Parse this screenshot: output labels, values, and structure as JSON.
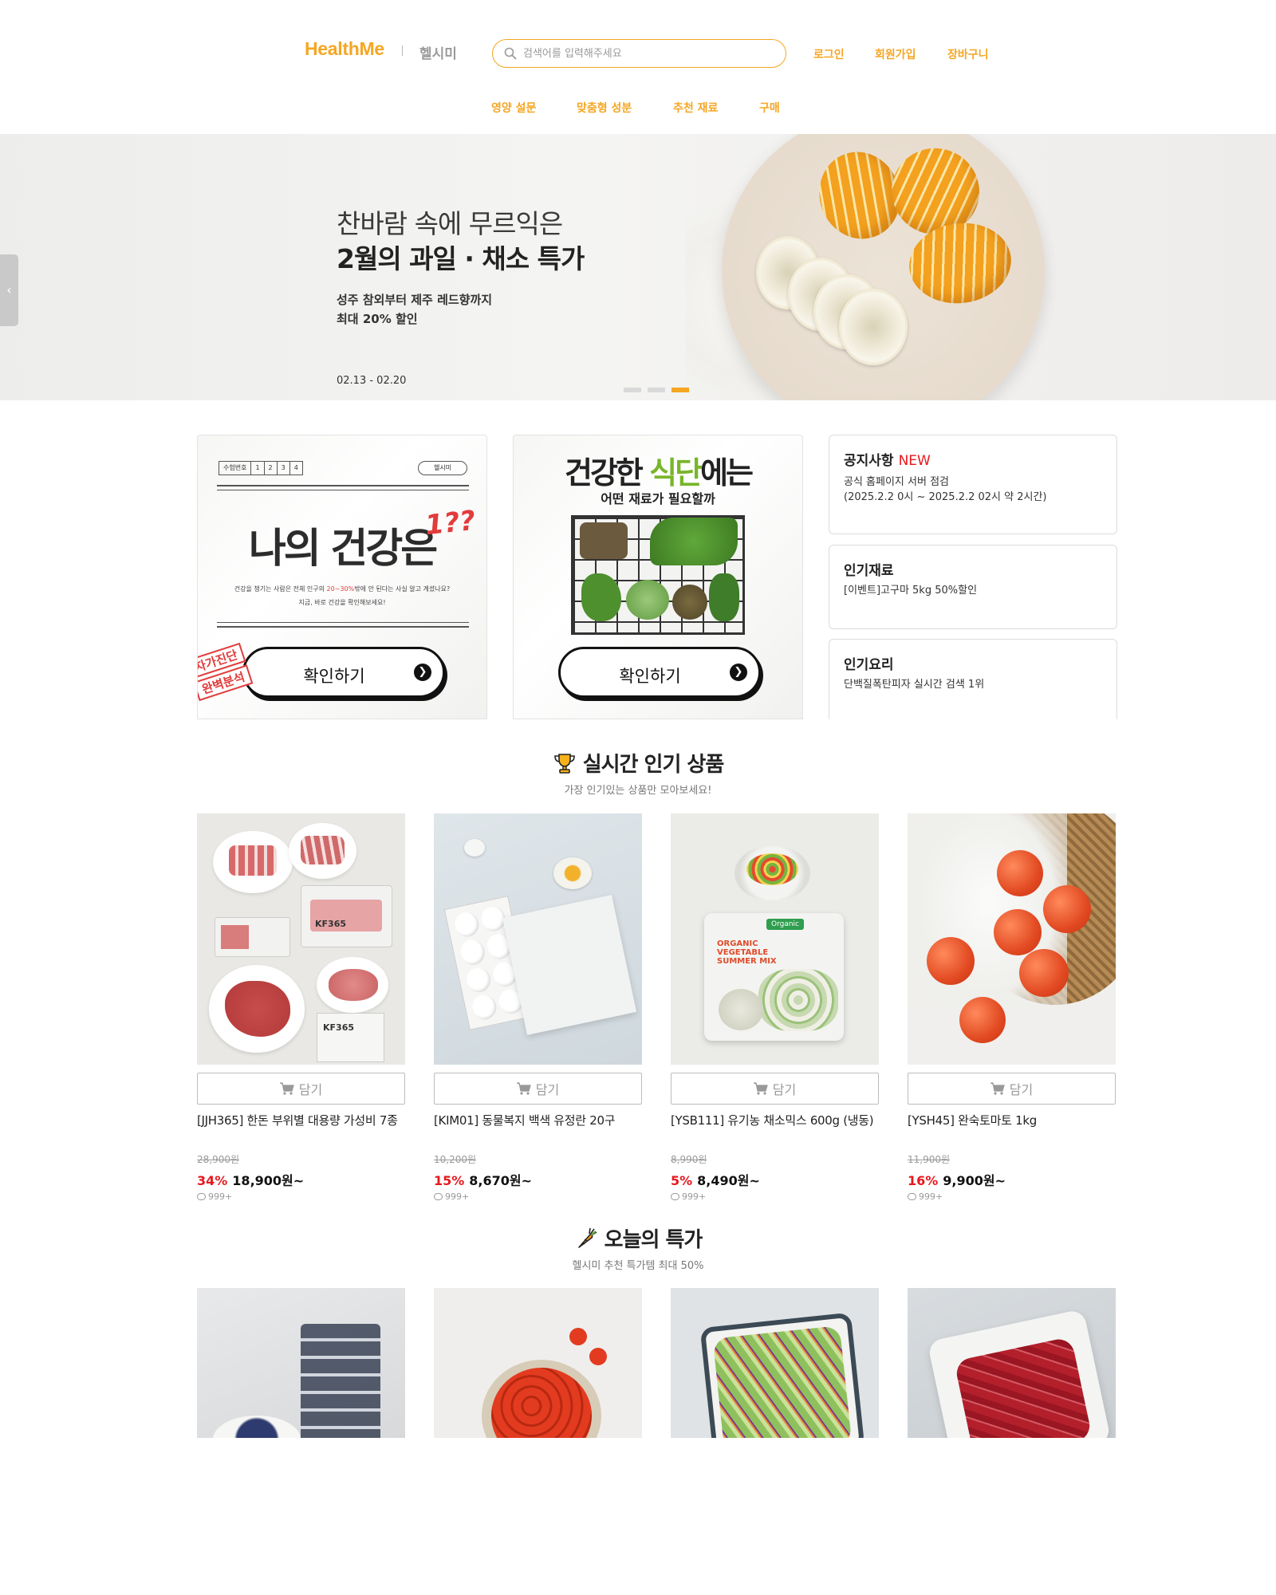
{
  "header": {
    "logo": "HealthMe",
    "logo_kr": "헬시미",
    "search_placeholder": "검색어를 입력해주세요",
    "links": {
      "login": "로그인",
      "signup": "회원가입",
      "cart": "장바구니"
    },
    "nav": [
      "영양 설문",
      "맞춤형 성분",
      "추천 재료",
      "구매"
    ]
  },
  "hero": {
    "subtitle": "찬바람 속에 무르익은",
    "title": "2월의 과일 · 채소 특가",
    "desc_line1": "성주 참외부터 제주 레드향까지",
    "desc_line2": "최대 20% 할인",
    "date": "02.13 - 02.20",
    "prev_icon": "chevron-left-icon",
    "slides": 3,
    "active_slide": 3
  },
  "card_survey": {
    "exam_label": "수험번호",
    "exam_digits": [
      "1",
      "2",
      "3",
      "4"
    ],
    "pill": "헬시미",
    "title": "나의 건강은",
    "scribble": "1??",
    "desc_line1_pre": "건강을 챙기는 사람은 전체 인구의 ",
    "desc_line1_em": "20~30%",
    "desc_line1_post": "밖에 안 된다는 사실 알고 계셨나요?",
    "desc_line2": "지금, 바로 건강을 확인해보세요!",
    "stamp_line1": "자가진단",
    "stamp_line2": "완벽분석",
    "cta": "확인하기"
  },
  "card_diet": {
    "title_pre": "건강한 ",
    "title_green": "식단",
    "title_post": "에는",
    "subtitle": "어떤 재료가 필요할까",
    "cta": "확인하기"
  },
  "notices": [
    {
      "title": "공지사항",
      "badge": "NEW",
      "body": "공식 홈페이지 서버 점검\n(2025.2.2 0시 ~ 2025.2.2 02시 약 2시간)"
    },
    {
      "title": "인기재료",
      "badge": "",
      "body": "[이벤트]고구마 5kg 50%할인"
    },
    {
      "title": "인기요리",
      "badge": "",
      "body": "단백질폭탄피자 실시간 검색 1위"
    }
  ],
  "popular": {
    "icon": "trophy-icon",
    "title": "실시간 인기 상품",
    "subtitle": "가장 인기있는 상품만 모아보세요!",
    "cart_label": "담기",
    "items": [
      {
        "name": "[JJH365] 한돈 부위별 대용량 가성비 7종",
        "orig": "28,900원",
        "discount": "34%",
        "price": "18,900원~",
        "reviews": "999+"
      },
      {
        "name": "[KIM01] 동물복지 백색 유정란 20구",
        "orig": "10,200원",
        "discount": "15%",
        "price": "8,670원~",
        "reviews": "999+"
      },
      {
        "name": "[YSB111] 유기농 채소믹스 600g (냉동)",
        "orig": "8,990원",
        "discount": "5%",
        "price": "8,490원~",
        "reviews": "999+"
      },
      {
        "name": "[YSH45] 완숙토마토 1kg",
        "orig": "11,900원",
        "discount": "16%",
        "price": "9,900원~",
        "reviews": "999+"
      }
    ]
  },
  "deals": {
    "icon": "carrot-icon",
    "title": "오늘의 특가",
    "subtitle": "헬시미 추천 특가템 최대 50%"
  },
  "product_text": {
    "kf365": "KF365",
    "organic_badge": "Organic",
    "veg_pack": "ORGANIC VEGETABLE SUMMER MIX"
  },
  "colors": {
    "accent": "#f5a623",
    "sale": "#e5191e",
    "diet_green": "#79b52b"
  }
}
